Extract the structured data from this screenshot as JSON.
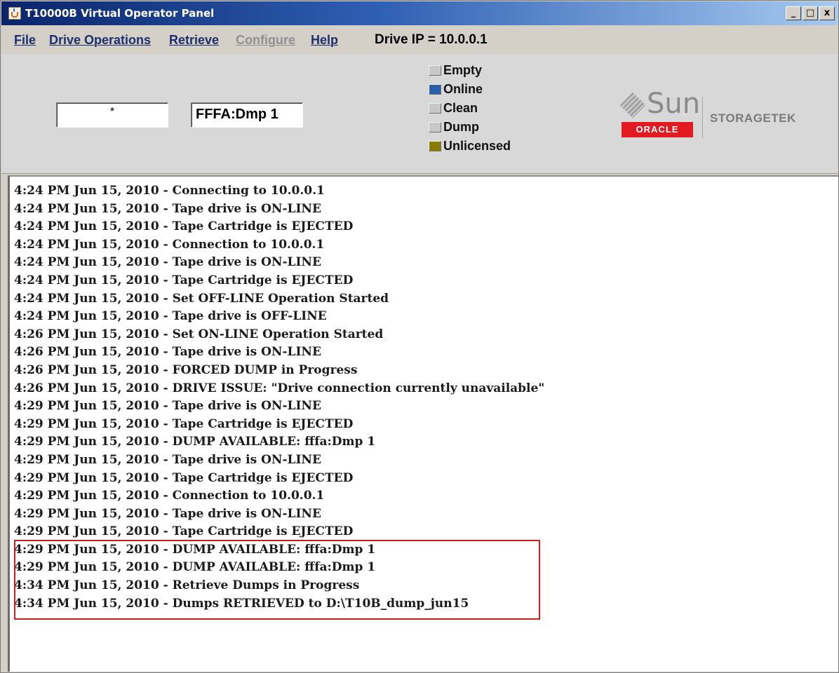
{
  "window": {
    "title": "T10000B Virtual Operator Panel",
    "controls": {
      "minimize": "_",
      "maximize": "□",
      "close": "x"
    }
  },
  "menu": {
    "items": [
      {
        "label": "File",
        "enabled": true
      },
      {
        "label": "Drive Operations",
        "enabled": true
      },
      {
        "label": "Retrieve",
        "enabled": true
      },
      {
        "label": "Configure",
        "enabled": false
      },
      {
        "label": "Help",
        "enabled": true
      }
    ],
    "drive_ip": "Drive IP = 10.0.0.1"
  },
  "panel": {
    "indicator_field": "*",
    "display_field": "FFFA:Dmp 1",
    "status_indicators": [
      {
        "label": "Empty",
        "color": "#c8c8c8"
      },
      {
        "label": "Online",
        "color": "#2b5ea8"
      },
      {
        "label": "Clean",
        "color": "#c8c8c8"
      },
      {
        "label": "Dump",
        "color": "#c8c8c8"
      },
      {
        "label": "Unlicensed",
        "color": "#8a7a00"
      }
    ]
  },
  "logo": {
    "sun": "Sun",
    "oracle": "ORACLE",
    "storagetek": "STORAGETEK"
  },
  "log": {
    "lines": [
      "4:24 PM Jun 15, 2010 - Connecting to 10.0.0.1",
      "4:24 PM Jun 15, 2010 - Tape drive is ON-LINE",
      "4:24 PM Jun 15, 2010 - Tape Cartridge is EJECTED",
      "4:24 PM Jun 15, 2010 - Connection to 10.0.0.1",
      "4:24 PM Jun 15, 2010 - Tape drive is ON-LINE",
      "4:24 PM Jun 15, 2010 - Tape Cartridge is EJECTED",
      "4:24 PM Jun 15, 2010 - Set OFF-LINE Operation Started",
      "4:24 PM Jun 15, 2010 - Tape drive is OFF-LINE",
      "4:26 PM Jun 15, 2010 - Set ON-LINE Operation Started",
      "4:26 PM Jun 15, 2010 - Tape drive is ON-LINE",
      "4:26 PM Jun 15, 2010 - FORCED DUMP in Progress",
      "4:26 PM Jun 15, 2010 - DRIVE ISSUE: \"Drive connection currently unavailable\"",
      "4:29 PM Jun 15, 2010 - Tape drive is ON-LINE",
      "4:29 PM Jun 15, 2010 - Tape Cartridge is EJECTED",
      "4:29 PM Jun 15, 2010 - DUMP AVAILABLE: fffa:Dmp 1",
      "4:29 PM Jun 15, 2010 - Tape drive is ON-LINE",
      "4:29 PM Jun 15, 2010 - Tape Cartridge is EJECTED",
      "4:29 PM Jun 15, 2010 - Connection to 10.0.0.1",
      "4:29 PM Jun 15, 2010 - Tape drive is ON-LINE",
      "4:29 PM Jun 15, 2010 - Tape Cartridge is EJECTED",
      "4:29 PM Jun 15, 2010 - DUMP AVAILABLE: fffa:Dmp 1",
      "4:29 PM Jun 15, 2010 - DUMP AVAILABLE: fffa:Dmp 1",
      "4:34 PM Jun 15, 2010 - Retrieve Dumps in Progress",
      "4:34 PM Jun 15, 2010 - Dumps RETRIEVED to D:\\T10B_dump_jun15"
    ],
    "highlight_color": "#c81e22"
  }
}
